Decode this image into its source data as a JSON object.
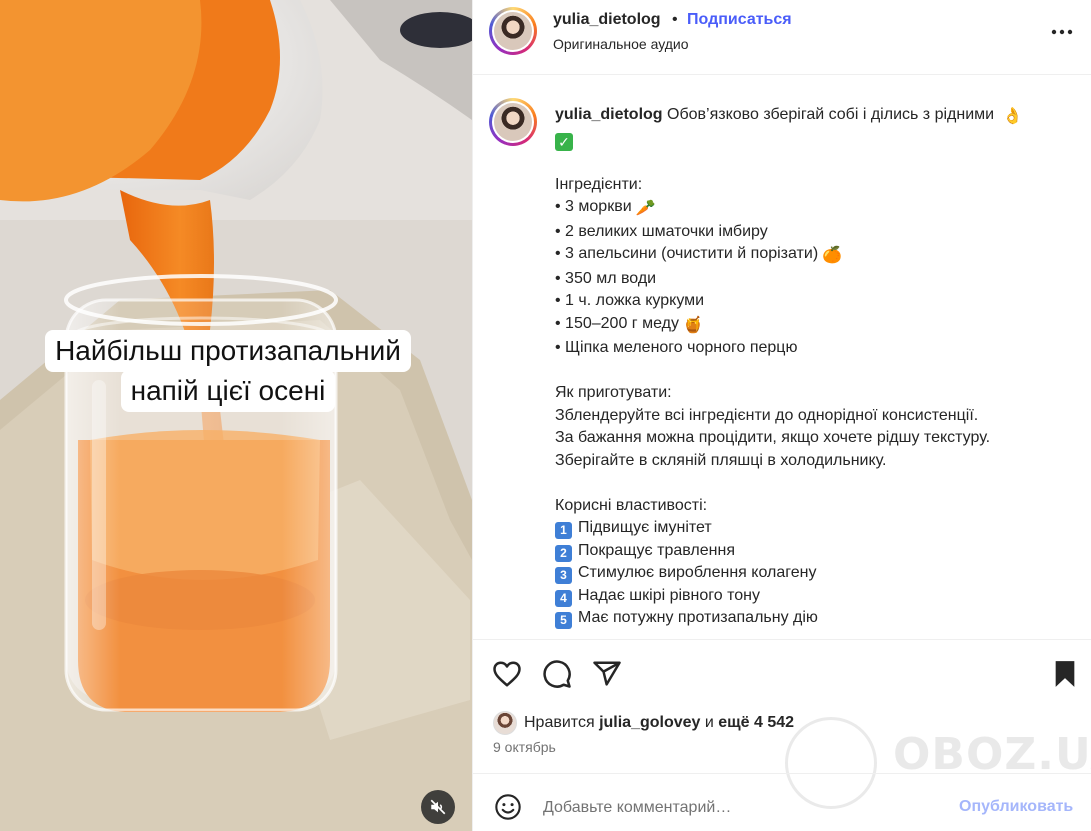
{
  "media": {
    "overlay_lines": [
      "Найбільш протизапальний",
      "напій цієї осені"
    ],
    "mute_icon": "speaker-muted-icon"
  },
  "header": {
    "username": "yulia_dietolog",
    "separator": "•",
    "follow_label": "Подписаться",
    "audio_label": "Оригинальное аудио",
    "more_icon": "more-horizontal-icon"
  },
  "caption": {
    "username": "yulia_dietolog",
    "intro": "Обов’язково зберігай собі і ділись з рідними",
    "ingredients_heading": "Інгредієнти:",
    "ingredients": [
      "• 3 моркви",
      "• 2 великих шматочки імбиру",
      "• 3 апельсини (очистити й порізати)",
      "• 350 мл води",
      "• 1 ч. ложка куркуми",
      "• 150–200 г меду",
      "• Щіпка меленого чорного перцю"
    ],
    "howto_heading": "Як приготувати:",
    "howto": [
      "Зблендеруйте всі інгредієнти до однорідної консистенції.",
      "За бажання можна процідити, якщо хочете рідшу текстуру.",
      "Зберігайте в скляній пляшці в холодильнику."
    ],
    "benefits_heading": "Корисні властивості:",
    "benefits": [
      {
        "num": "1",
        "text": "Підвищує імунітет"
      },
      {
        "num": "2",
        "text": "Покращує травлення"
      },
      {
        "num": "3",
        "text": "Стимулює вироблення колагену"
      },
      {
        "num": "4",
        "text": "Надає шкірі рівного тону"
      },
      {
        "num": "5",
        "text": "Має потужну протизапальну дію"
      }
    ]
  },
  "actions": {
    "like_icon": "heart-icon",
    "comment_icon": "comment-icon",
    "share_icon": "share-icon",
    "save_icon": "bookmark-icon"
  },
  "likes": {
    "prefix": "Нравится",
    "user": "julia_golovey",
    "middle": "и",
    "rest": "ещё 4 542"
  },
  "date": "9 октябрь",
  "comment": {
    "placeholder": "Добавьте комментарий…",
    "publish_label": "Опубликовать",
    "emoji_icon": "smiley-icon"
  },
  "watermark": {
    "text": "OBOZ.UA"
  },
  "colors": {
    "follow": "#4a5df9",
    "publish_disabled": "#a5b6fb",
    "juice": "#f07a1a"
  }
}
